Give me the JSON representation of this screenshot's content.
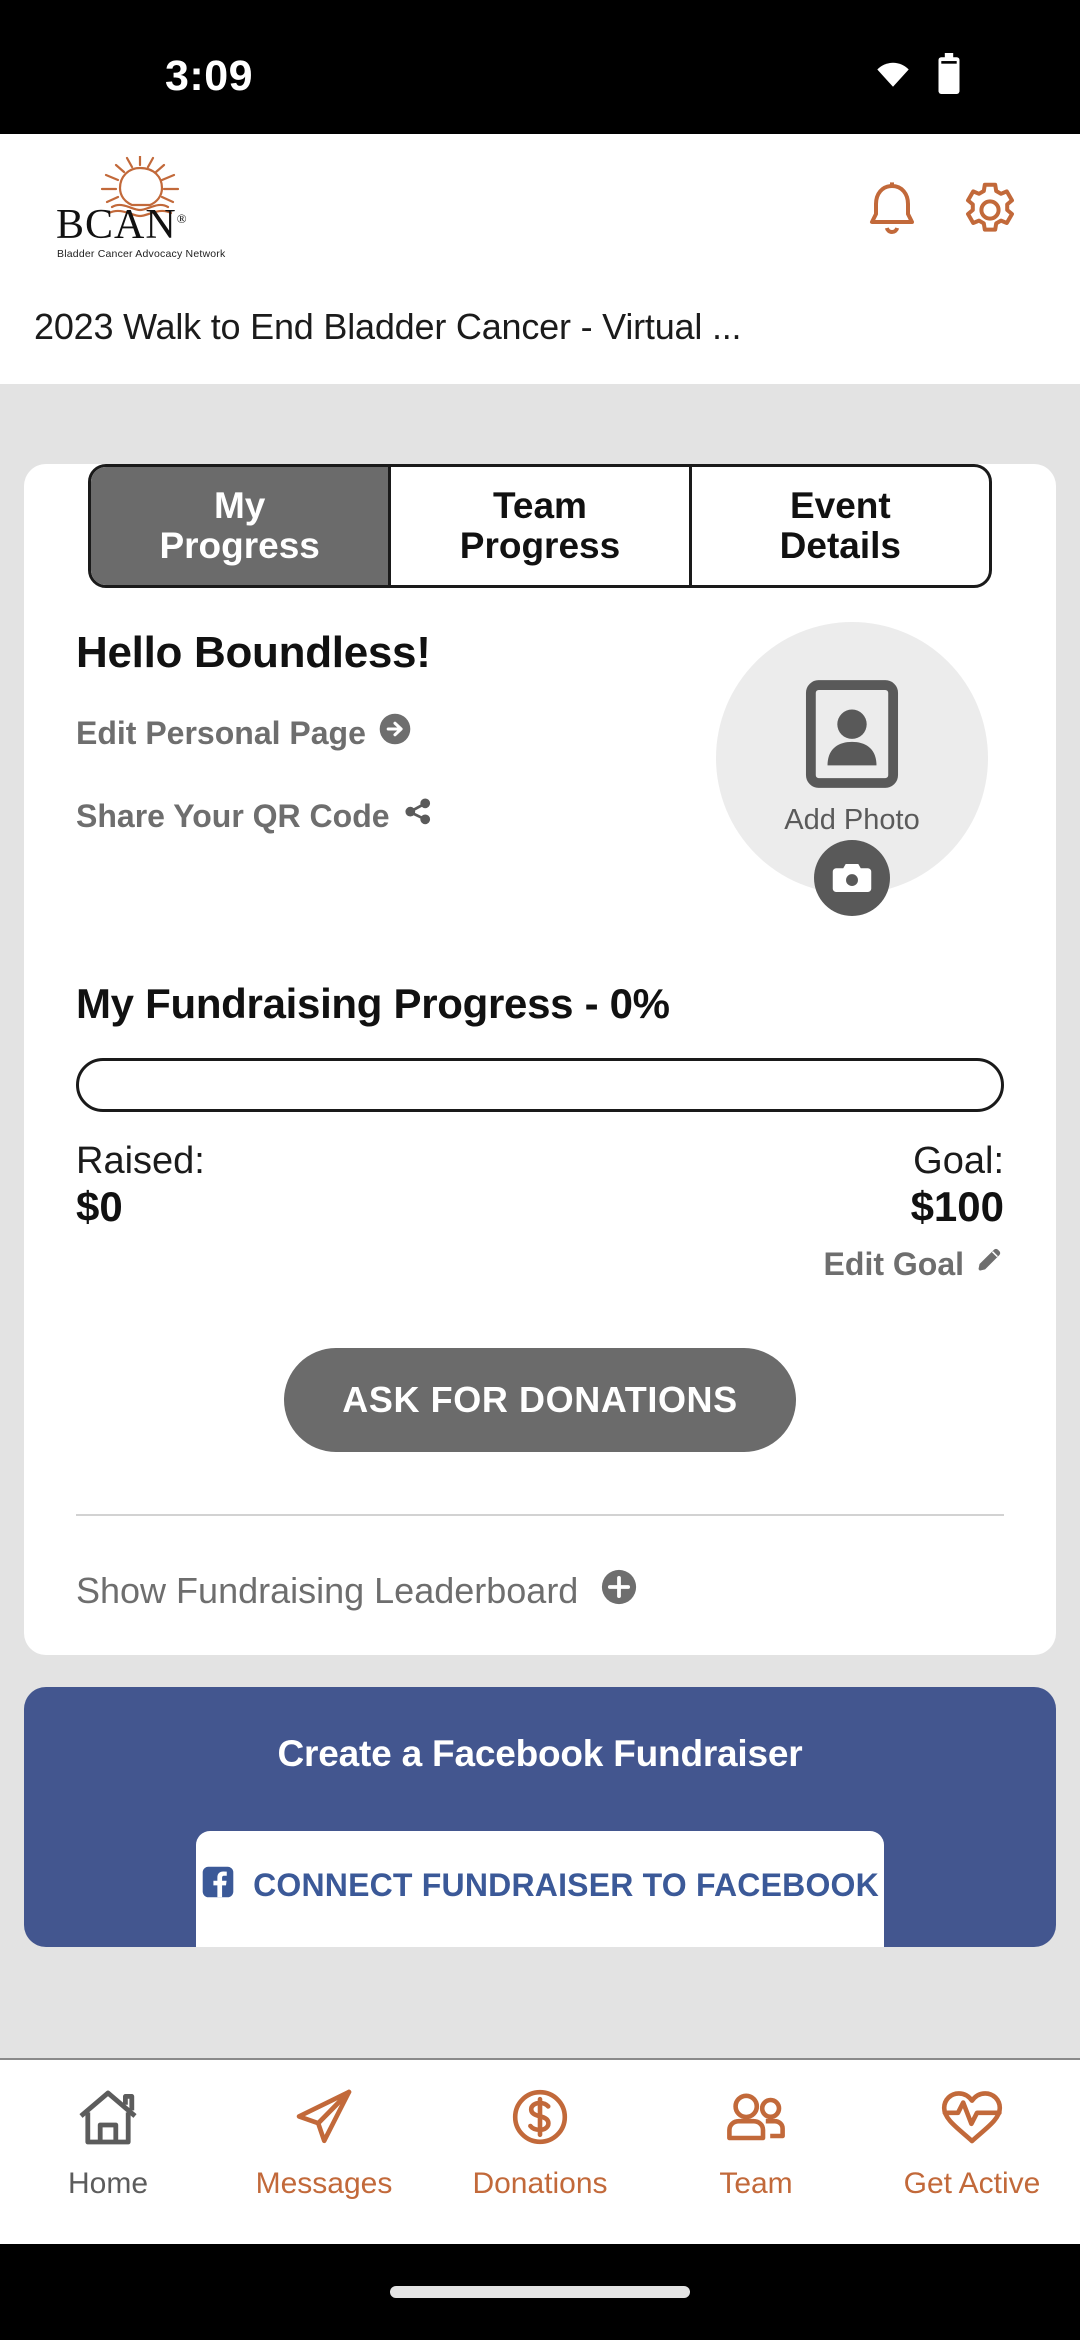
{
  "status_bar": {
    "time": "3:09",
    "wifi_icon": "wifi-icon",
    "battery_icon": "battery-full-icon"
  },
  "header": {
    "logo_text": "BCAN",
    "logo_registered": "®",
    "logo_tagline": "Bladder Cancer Advocacy Network",
    "notifications_icon": "bell-icon",
    "settings_icon": "gear-icon",
    "event_title": "2023 Walk to End Bladder Cancer - Virtual ..."
  },
  "tabs": [
    {
      "line1": "My",
      "line2": "Progress",
      "active": true
    },
    {
      "line1": "Team",
      "line2": "Progress",
      "active": false
    },
    {
      "line1": "Event",
      "line2": "Details",
      "active": false
    }
  ],
  "profile": {
    "greeting": "Hello Boundless!",
    "edit_page_label": "Edit Personal Page",
    "edit_page_icon": "arrow-right-circle-icon",
    "share_qr_label": "Share Your QR Code",
    "share_icon": "share-icon",
    "avatar_label": "Add Photo",
    "avatar_icon": "portrait-placeholder-icon",
    "camera_icon": "camera-icon"
  },
  "fundraising": {
    "progress_title": "My Fundraising Progress - 0%",
    "progress_percent": 0,
    "raised_label": "Raised:",
    "raised_value": "$0",
    "goal_label": "Goal:",
    "goal_value": "$100",
    "edit_goal_label": "Edit Goal",
    "edit_goal_icon": "pencil-icon",
    "ask_button_label": "ASK FOR DONATIONS",
    "leaderboard_label": "Show Fundraising Leaderboard",
    "leaderboard_icon": "plus-circle-icon"
  },
  "facebook_card": {
    "title": "Create a Facebook Fundraiser",
    "button_label": "CONNECT FUNDRAISER TO FACEBOOK",
    "facebook_icon": "facebook-icon",
    "background_color": "#43568f",
    "button_text_color": "#3b5998"
  },
  "bottom_nav": [
    {
      "label": "Home",
      "icon": "home-icon",
      "active": true
    },
    {
      "label": "Messages",
      "icon": "paper-plane-icon",
      "active": false
    },
    {
      "label": "Donations",
      "icon": "dollar-circle-icon",
      "active": false
    },
    {
      "label": "Team",
      "icon": "people-icon",
      "active": false
    },
    {
      "label": "Get Active",
      "icon": "heart-pulse-icon",
      "active": false
    }
  ],
  "colors": {
    "accent_orange": "#c2693a",
    "gray_button": "#6b6b6b",
    "facebook_blue": "#43568f",
    "page_background": "#e3e3e3"
  }
}
